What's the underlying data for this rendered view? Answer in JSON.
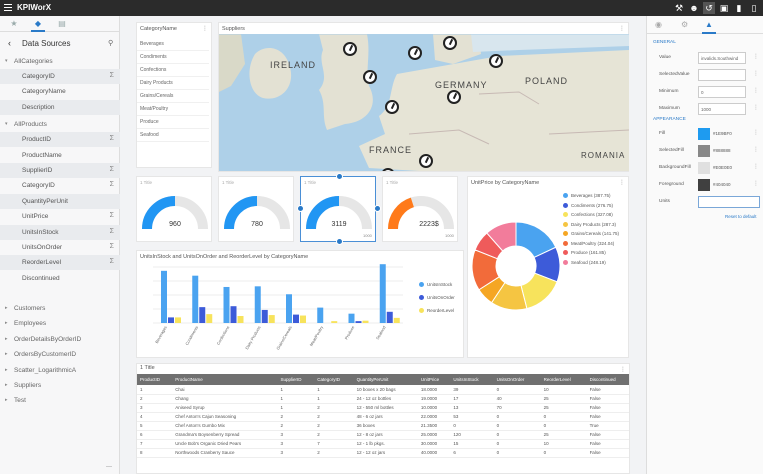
{
  "app": {
    "title": "KPIWorX"
  },
  "toolbar": {
    "icons": [
      "wrench-icon",
      "user-icon",
      "share-icon",
      "monitor-icon",
      "layout-icon",
      "window-icon"
    ]
  },
  "sidebar": {
    "header": "Data Sources",
    "tabs": [
      "star-icon",
      "tag-icon",
      "layers-icon"
    ],
    "groups": [
      {
        "label": "AllCategories",
        "expanded": true,
        "fields": [
          {
            "label": "CategoryID",
            "sum": true
          },
          {
            "label": "CategoryName",
            "sum": false
          },
          {
            "label": "Description",
            "sum": false
          }
        ]
      },
      {
        "label": "AllProducts",
        "expanded": true,
        "fields": [
          {
            "label": "ProductID",
            "sum": true
          },
          {
            "label": "ProductName",
            "sum": false
          },
          {
            "label": "SupplierID",
            "sum": true
          },
          {
            "label": "CategoryID",
            "sum": true
          },
          {
            "label": "QuantityPerUnit",
            "sum": false
          },
          {
            "label": "UnitPrice",
            "sum": true
          },
          {
            "label": "UnitsInStock",
            "sum": true
          },
          {
            "label": "UnitsOnOrder",
            "sum": true
          },
          {
            "label": "ReorderLevel",
            "sum": true
          },
          {
            "label": "Discontinued",
            "sum": false
          }
        ]
      }
    ],
    "collapsed_groups": [
      "Customers",
      "Employees",
      "OrderDetailsByOrderID",
      "OrdersByCustomerID",
      "Scatter_LogarithmicA",
      "Suppliers",
      "Test"
    ]
  },
  "category_list": {
    "title": "CategoryName",
    "items": [
      "Beverages",
      "Condiments",
      "Confections",
      "Dairy Products",
      "Grains/Cereals",
      "Meat/Poultry",
      "Produce",
      "Seafood"
    ]
  },
  "map": {
    "title": "Suppliers",
    "labels": {
      "ireland": "IRELAND",
      "germany": "GERMANY",
      "poland": "POLAND",
      "france": "FRANCE",
      "romania": "ROMANIA"
    }
  },
  "gauges": [
    {
      "title": "1 Title",
      "value": "960",
      "fraction": 0.5,
      "color": "#2196f3"
    },
    {
      "title": "1 Title",
      "value": "780",
      "fraction": 0.5,
      "color": "#2196f3"
    },
    {
      "title": "1 Title",
      "value": "3119",
      "fraction": 0.5,
      "color": "#2196f3"
    },
    {
      "title": "1 Title",
      "value": "2223$",
      "fraction": 0.4,
      "color": "#ff7a1a"
    }
  ],
  "gauge_max": "1000",
  "chart_data": [
    {
      "type": "bar",
      "title": "UnitsInStock and UnitsOnOrder and ReorderLevel by CategoryName",
      "categories": [
        "Beverages",
        "Condiments",
        "Confections",
        "Dairy Products",
        "Grains/Cereals",
        "Meat/Poultry",
        "Produce",
        "Seafood"
      ],
      "ylim": [
        0,
        600
      ],
      "series": [
        {
          "name": "UnitsInStock",
          "color": "#4aa3f0",
          "values": [
            559,
            507,
            386,
            393,
            308,
            165,
            100,
            701
          ]
        },
        {
          "name": "UnitsOnOrder",
          "color": "#3d5bd9",
          "values": [
            60,
            170,
            180,
            140,
            90,
            0,
            20,
            120
          ]
        },
        {
          "name": "ReorderLevel",
          "color": "#f7e35c",
          "values": [
            60,
            95,
            75,
            85,
            80,
            20,
            25,
            55
          ]
        }
      ]
    },
    {
      "type": "pie",
      "title": "UnitPrice by CategoryName",
      "slices": [
        {
          "label": "Beverages (387.75)",
          "value": 387.75,
          "color": "#4aa3f0"
        },
        {
          "label": "Condiments (276.75)",
          "value": 276.75,
          "color": "#3d5bd9"
        },
        {
          "label": "Confections (327.08)",
          "value": 327.08,
          "color": "#f7e35c"
        },
        {
          "label": "Dairy Products (287.3)",
          "value": 287.3,
          "color": "#f5c542"
        },
        {
          "label": "Grains/Cereals (141.75)",
          "value": 141.75,
          "color": "#f5a623"
        },
        {
          "label": "Meat/Poultry (324.04)",
          "value": 324.04,
          "color": "#f26b3a"
        },
        {
          "label": "Produce (161.85)",
          "value": 161.85,
          "color": "#ef5b5b"
        },
        {
          "label": "Seafood (248.19)",
          "value": 248.19,
          "color": "#f27c9b"
        }
      ]
    }
  ],
  "grid": {
    "title": "1 Title",
    "columns": [
      "ProductID",
      "ProductName",
      "SupplierID",
      "CategoryID",
      "QuantityPerUnit",
      "UnitPrice",
      "UnitsInStock",
      "UnitsOnOrder",
      "ReorderLevel",
      "Discontinued"
    ],
    "rows": [
      [
        "1",
        "Chai",
        "1",
        "1",
        "10 boxes x 20 bags",
        "18.0000",
        "39",
        "0",
        "10",
        "False"
      ],
      [
        "2",
        "Chang",
        "1",
        "1",
        "24 - 12 oz bottles",
        "19.0000",
        "17",
        "40",
        "25",
        "False"
      ],
      [
        "3",
        "Aniseed Syrup",
        "1",
        "2",
        "12 - 550 ml bottles",
        "10.0000",
        "13",
        "70",
        "25",
        "False"
      ],
      [
        "4",
        "Chef Anton's Cajun Seasoning",
        "2",
        "2",
        "48 - 6 oz jars",
        "22.0000",
        "53",
        "0",
        "0",
        "False"
      ],
      [
        "5",
        "Chef Anton's Gumbo Mix",
        "2",
        "2",
        "36 boxes",
        "21.3500",
        "0",
        "0",
        "0",
        "True"
      ],
      [
        "6",
        "Grandma's Boysenberry Spread",
        "3",
        "2",
        "12 - 8 oz jars",
        "25.0000",
        "120",
        "0",
        "25",
        "False"
      ],
      [
        "7",
        "Uncle Bob's Organic Dried Pears",
        "3",
        "7",
        "12 - 1 lb pkgs.",
        "30.0000",
        "15",
        "0",
        "10",
        "False"
      ],
      [
        "8",
        "Northwoods Cranberry Sauce",
        "3",
        "2",
        "12 - 12 oz jars",
        "40.0000",
        "6",
        "0",
        "0",
        "False"
      ]
    ]
  },
  "properties": {
    "tabs": [
      "palette-icon",
      "settings-icon",
      "paint-bucket-icon"
    ],
    "general_label": "GENERAL",
    "appearance_label": "APPEARANCE",
    "general": [
      {
        "label": "Value",
        "value": "invalids.Southwind"
      },
      {
        "label": "SelectedValue",
        "value": ""
      },
      {
        "label": "Minimum",
        "value": "0"
      },
      {
        "label": "Maximum",
        "value": "1000"
      }
    ],
    "appearance": [
      {
        "label": "Fill",
        "color": "#1e9bf0",
        "value": "#1E9BF0"
      },
      {
        "label": "SelectedFill",
        "color": "#888888",
        "value": "#888888"
      },
      {
        "label": "BackgroundFill",
        "color": "#e0e0e0",
        "value": "#E0E0E0"
      },
      {
        "label": "Foreground",
        "color": "#404040",
        "value": "#404040"
      },
      {
        "label": "Units",
        "value": ""
      }
    ],
    "reset_label": "Reset to default"
  }
}
